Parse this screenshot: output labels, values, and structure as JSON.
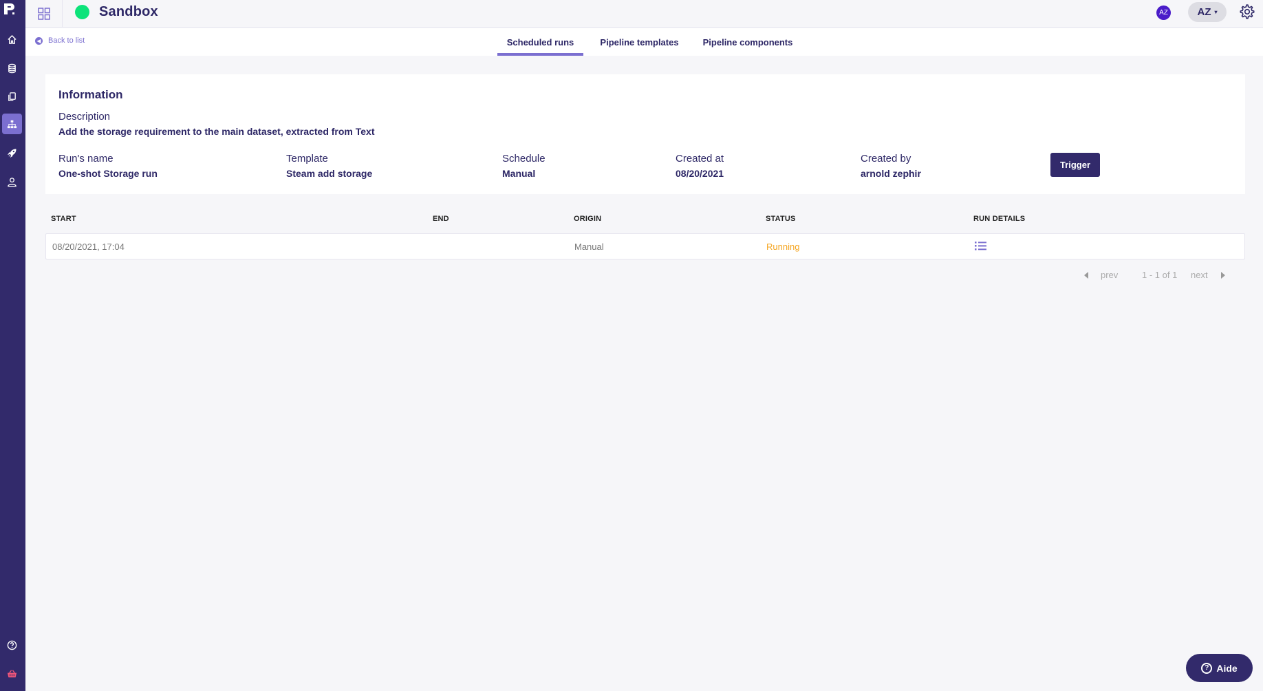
{
  "header": {
    "app_title": "Sandbox",
    "status_color": "#0de37a",
    "avatar_initials": "AZ",
    "user_menu_label": "AZ",
    "user_menu_caret": "▾"
  },
  "sidebar": {
    "logo": "P.",
    "items": [
      {
        "name": "home",
        "icon": "home-icon"
      },
      {
        "name": "datasets",
        "icon": "database-icon"
      },
      {
        "name": "documents",
        "icon": "copy-icon"
      },
      {
        "name": "pipelines",
        "icon": "sitemap-icon",
        "active": true
      },
      {
        "name": "deployments",
        "icon": "rocket-icon"
      },
      {
        "name": "users",
        "icon": "user-icon"
      }
    ],
    "bottom_items": [
      {
        "name": "help",
        "icon": "help-icon"
      },
      {
        "name": "marketplace",
        "icon": "basket-icon"
      }
    ]
  },
  "nav": {
    "back_label": "Back to list",
    "tabs": [
      {
        "label": "Scheduled runs",
        "active": true
      },
      {
        "label": "Pipeline templates",
        "active": false
      },
      {
        "label": "Pipeline components",
        "active": false
      }
    ]
  },
  "info": {
    "title": "Information",
    "description_label": "Description",
    "description_value": "Add the storage requirement to the main dataset, extracted from Text",
    "fields": [
      {
        "label": "Run's name",
        "value": "One-shot Storage run"
      },
      {
        "label": "Template",
        "value": "Steam add storage"
      },
      {
        "label": "Schedule",
        "value": "Manual"
      },
      {
        "label": "Created at",
        "value": "08/20/2021"
      },
      {
        "label": "Created by",
        "value": "arnold zephir"
      }
    ],
    "trigger_label": "Trigger"
  },
  "table": {
    "columns": [
      "START",
      "END",
      "ORIGIN",
      "STATUS",
      "RUN DETAILS"
    ],
    "rows": [
      {
        "start": "08/20/2021, 17:04",
        "end": "",
        "origin": "Manual",
        "status": "Running",
        "status_color": "#f5a623"
      }
    ]
  },
  "pagination": {
    "prev_label": "prev",
    "range_label": "1 - 1 of 1",
    "next_label": "next"
  },
  "help_button": {
    "label": "Aide"
  }
}
